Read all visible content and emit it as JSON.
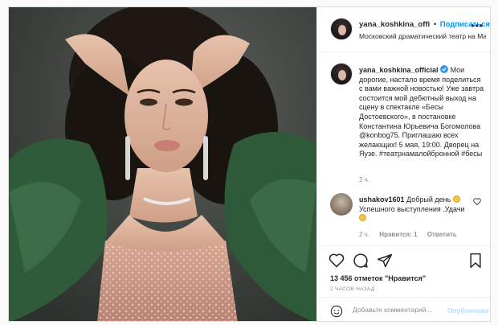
{
  "header": {
    "username": "yana_koshkina_offi",
    "separator": "•",
    "follow_label": "Подписаться",
    "location": "Московский драматический театр на Мало...",
    "more_label": "•••"
  },
  "caption": {
    "username": "yana_koshkina_official",
    "text": "Мои дорогие, настало время поделиться с вами важной новостью! Уже завтра состоится мой дебютный выход на сцену в спектакле «Бесы Достоевского», в постановке Константина Юрьевича Богомолова @konbog75. Приглашаю всех желающих! 5 мая, 19:00. Дворец на Яузе. #театрнамалойбронной #бесы",
    "time": "2 ч."
  },
  "comment": {
    "username": "ushakov1601",
    "text_before": "Добрый день",
    "text_after": "Успешного выступления .Удачи",
    "time": "2 ч.",
    "likes_label": "Нравится: 1",
    "reply_label": "Ответить"
  },
  "actions": {
    "likes": "13 456 отметок \"Нравится\"",
    "posted_ago": "2 ЧАСОВ НАЗАД",
    "comment_placeholder": "Добавьте комментарий...",
    "publish_label": "Опубликовать"
  },
  "icons": {
    "verified": "verified-badge-icon",
    "heart": "heart-icon",
    "comment": "comment-icon",
    "share": "share-icon",
    "save": "bookmark-icon",
    "emoji": "emoji-icon"
  },
  "colors": {
    "accent": "#0095f6",
    "publish_disabled": "#b2dffc",
    "muted": "#8e8e8e",
    "text": "#262626"
  }
}
